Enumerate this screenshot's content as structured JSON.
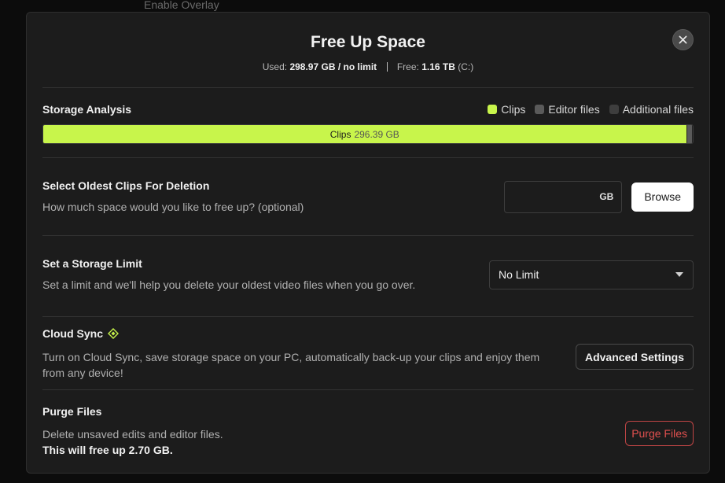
{
  "background": {
    "overlay_label": "Enable Overlay"
  },
  "modal": {
    "title": "Free Up Space",
    "usage": {
      "used_label": "Used:",
      "used_value": "298.97 GB / no limit",
      "free_label": "Free:",
      "free_value": "1.16 TB",
      "drive": "(C:)"
    },
    "close_icon": "close-icon"
  },
  "analysis": {
    "title": "Storage Analysis",
    "legend": [
      {
        "label": "Clips",
        "color": "#c8f54b"
      },
      {
        "label": "Editor files",
        "color": "#5a5a5a"
      },
      {
        "label": "Additional files",
        "color": "#3e3e3e"
      }
    ],
    "bar": {
      "clips_label": "Clips",
      "clips_value": "296.39 GB",
      "clips_fraction": 0.9914,
      "editor_fraction": 0.009,
      "additional_fraction": 0.0
    }
  },
  "oldest_clips": {
    "title": "Select Oldest Clips For Deletion",
    "description": "How much space would you like to free up? (optional)",
    "input_value": "",
    "unit": "GB",
    "browse_label": "Browse"
  },
  "storage_limit": {
    "title": "Set a Storage Limit",
    "description": "Set a limit and we'll help you delete your oldest video files when you go over.",
    "selected": "No Limit",
    "dropdown_icon": "caret-down-icon"
  },
  "cloud_sync": {
    "title": "Cloud Sync",
    "badge_icon": "diamond-icon",
    "description": "Turn on Cloud Sync, save storage space on your PC, automatically back-up your clips and enjoy them from any device!",
    "button_label": "Advanced Settings"
  },
  "purge": {
    "title": "Purge Files",
    "description": "Delete unsaved edits and editor files.",
    "free_up_text": "This will free up 2.70 GB.",
    "button_label": "Purge Files"
  },
  "colors": {
    "accent": "#c8f54b",
    "danger": "#e2504f",
    "modal_bg": "#1c1c1c"
  }
}
